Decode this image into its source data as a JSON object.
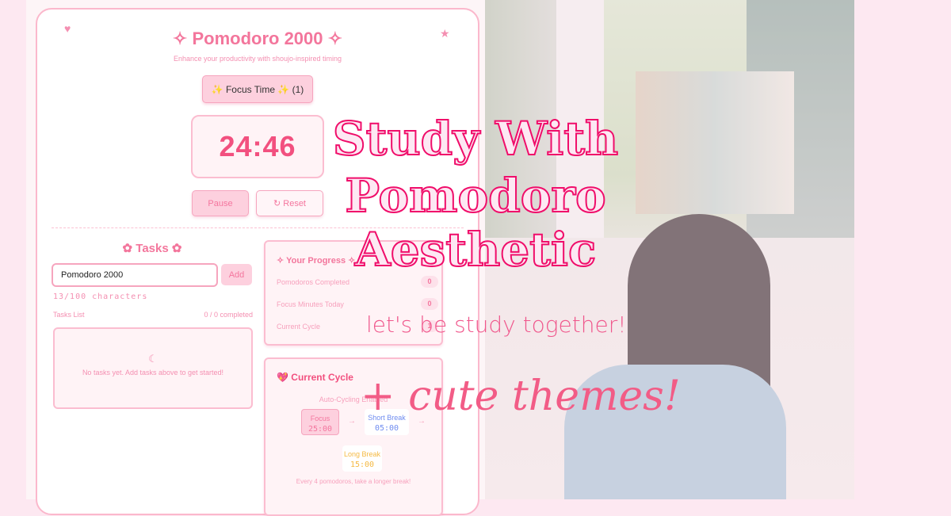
{
  "app": {
    "title": "✧ Pomodoro 2000 ✧",
    "subtitle": "Enhance your productivity with shoujo-inspired timing",
    "heart_icon": "heart-icon",
    "star_icon": "star-icon"
  },
  "timer": {
    "mode_label": "✨ Focus Time ✨ (1)",
    "time": "24:46",
    "pause_label": "Pause",
    "reset_label": "↻ Reset"
  },
  "tasks": {
    "heading": "✿ Tasks ✿",
    "input_value": "Pomodoro 2000",
    "add_label": "Add",
    "char_count": "13/100 characters",
    "list_label": "Tasks List",
    "completed": "0 / 0 completed",
    "empty_icon": "☾",
    "empty_text": "No tasks yet. Add tasks above to get started!"
  },
  "progress": {
    "heading": "✧ Your Progress ✧",
    "rows": [
      {
        "label": "Pomodoros Completed",
        "value": "0"
      },
      {
        "label": "Focus Minutes Today",
        "value": "0"
      },
      {
        "label": "Current Cycle",
        "value": "1"
      }
    ]
  },
  "cycle": {
    "heading": "💖 Current Cycle",
    "auto": "Auto-Cycling Enabled",
    "focus": {
      "label": "Focus",
      "time": "25:00"
    },
    "short": {
      "label": "Short Break",
      "time": "05:00"
    },
    "long": {
      "label": "Long Break",
      "time": "15:00"
    },
    "arrow": "→",
    "note": "Every 4 pomodoros, take a longer break!"
  },
  "overlay": {
    "line1": "Study With",
    "line2": "Pomodoro",
    "line3": "Aesthetic",
    "tagline": "let's be study together!",
    "extra": "+ cute themes!"
  },
  "colors": {
    "accent": "#f3769c",
    "timer": "#f2507f",
    "background": "#fde8f1",
    "headline_stroke": "#f00d6a"
  }
}
